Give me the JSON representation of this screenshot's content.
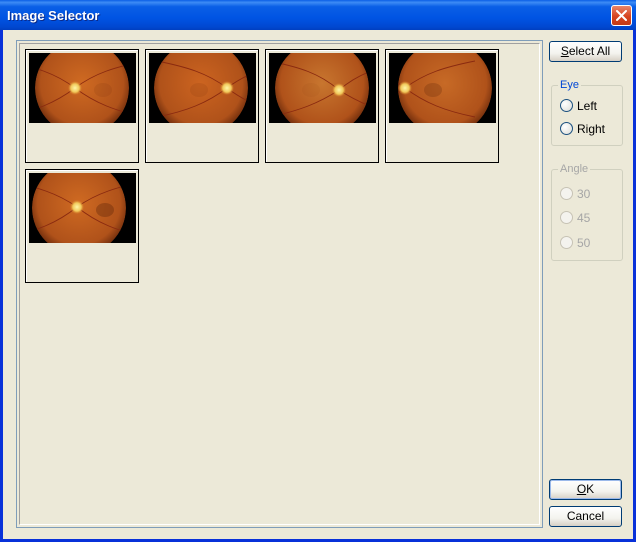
{
  "window": {
    "title": "Image Selector"
  },
  "images": [
    {
      "name": "fundus-image-1",
      "eye": "left"
    },
    {
      "name": "fundus-image-2",
      "eye": "left"
    },
    {
      "name": "fundus-image-3",
      "eye": "left"
    },
    {
      "name": "fundus-image-4",
      "eye": "right"
    },
    {
      "name": "fundus-image-5",
      "eye": "left"
    }
  ],
  "buttons": {
    "select_all": "Select All",
    "select_all_mnemonic": "S",
    "select_all_rest": "elect All",
    "ok": "OK",
    "ok_mnemonic": "O",
    "ok_rest": "K",
    "cancel": "Cancel"
  },
  "eye_group": {
    "label": "Eye",
    "options": [
      "Left",
      "Right"
    ]
  },
  "angle_group": {
    "label": "Angle",
    "options": [
      "30",
      "45",
      "50"
    ]
  },
  "colors": {
    "title_blue": "#0054e3",
    "fundus_orange": "#d0681f",
    "group_label_blue": "#0046d5"
  },
  "icons": {
    "close": "close-x-icon"
  }
}
